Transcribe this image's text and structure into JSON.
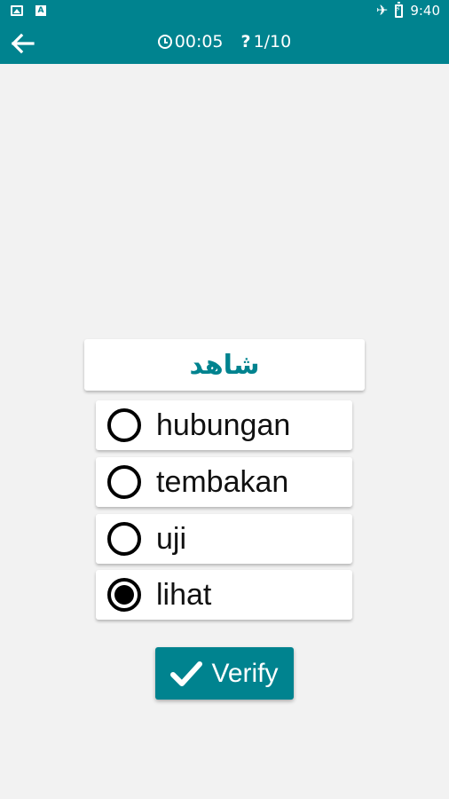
{
  "status_bar": {
    "time": "9:40",
    "left_icons": [
      "image-icon",
      "a-icon"
    ],
    "right_icons": [
      "airplane-icon",
      "battery-icon"
    ]
  },
  "header": {
    "back_icon": "arrow-left-icon",
    "timer": "00:05",
    "progress": "1/10"
  },
  "question": {
    "word": "شاهد"
  },
  "options": [
    {
      "label": "hubungan",
      "selected": false
    },
    {
      "label": "tembakan",
      "selected": false
    },
    {
      "label": "uji",
      "selected": false
    },
    {
      "label": "lihat",
      "selected": true
    }
  ],
  "verify": {
    "label": "Verify",
    "icon": "check-icon"
  },
  "colors": {
    "accent": "#00838f",
    "background": "#f2f2f2"
  }
}
